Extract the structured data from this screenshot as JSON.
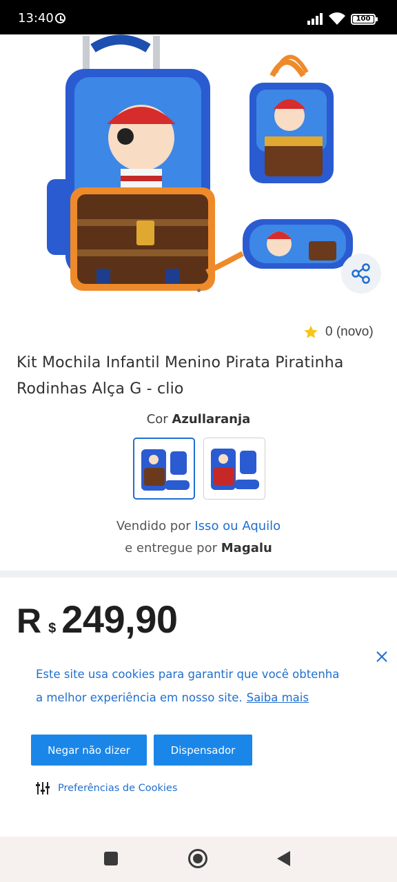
{
  "status_bar": {
    "time": "13:40",
    "battery": "100"
  },
  "product": {
    "title": "Kit Mochila Infantil Menino Pirata Piratinha Rodinhas Alça G - clio",
    "rating_text": "0 (novo)",
    "color_label": "Cor",
    "color_value": "Azullaranja",
    "sold_by_prefix": "Vendido por",
    "seller_name": "Isso ou Aquilo",
    "delivered_by_prefix": "e entregue por",
    "delivery_name": "Magalu",
    "price_currency": "R",
    "price_symbol": "$",
    "price_value": "249,90"
  },
  "cookie_banner": {
    "text_line1": "Este site usa cookies para garantir que você obtenha",
    "text_line2": "a melhor experiência em nosso site.",
    "link_text": "Saiba mais",
    "deny_button": "Negar não dizer",
    "dismiss_button": "Dispensador",
    "preferences_link": "Preferências de Cookies"
  },
  "colors": {
    "accent": "#1f6fcf",
    "button": "#1a86e8",
    "star": "#f5c518"
  }
}
